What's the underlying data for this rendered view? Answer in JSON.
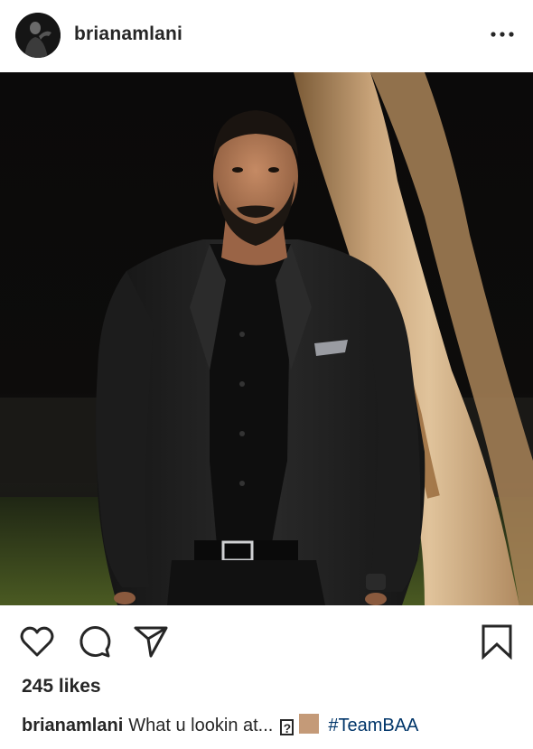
{
  "post": {
    "username": "brianamlani",
    "more_icon": "more-horizontal-icon"
  },
  "actions": {
    "like_icon": "heart-icon",
    "comment_icon": "comment-icon",
    "share_icon": "share-icon",
    "save_icon": "bookmark-icon"
  },
  "likes_text": "245 likes",
  "caption": {
    "username": "brianamlani",
    "text": "What u lookin at...",
    "unknown_glyph": "?",
    "swatch_color": "#c49a78",
    "hashtag": "#TeamBAA"
  },
  "colors": {
    "text": "#262626",
    "hashtag": "#003569"
  }
}
